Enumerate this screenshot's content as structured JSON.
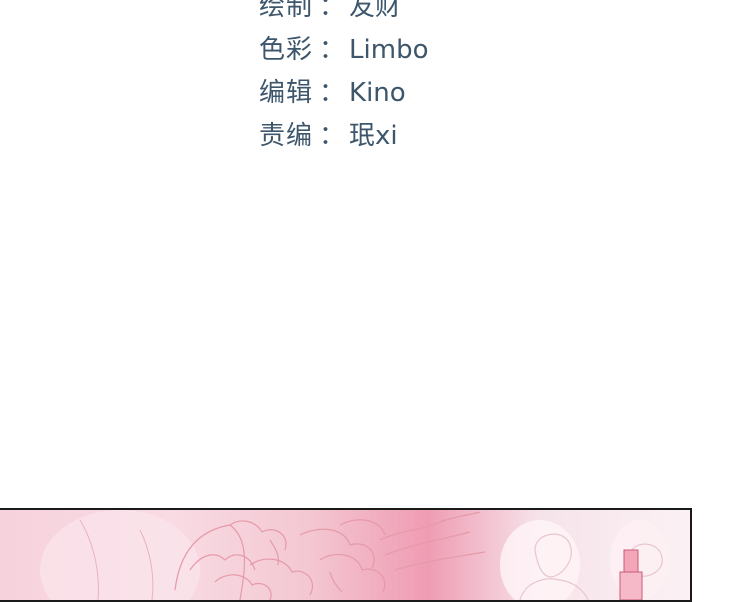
{
  "credits": [
    {
      "role": "绘制",
      "separator": "：",
      "name": "友财"
    },
    {
      "role": "色彩",
      "separator": "：",
      "name": "Limbo"
    },
    {
      "role": "编辑",
      "separator": "：",
      "name": "Kino"
    },
    {
      "role": "责编",
      "separator": "：",
      "name": "珉xi"
    }
  ],
  "panel": {
    "accent_pink": "#ef9cb3",
    "flower_color": "#e59aa8",
    "icon": "flower-illustration"
  }
}
